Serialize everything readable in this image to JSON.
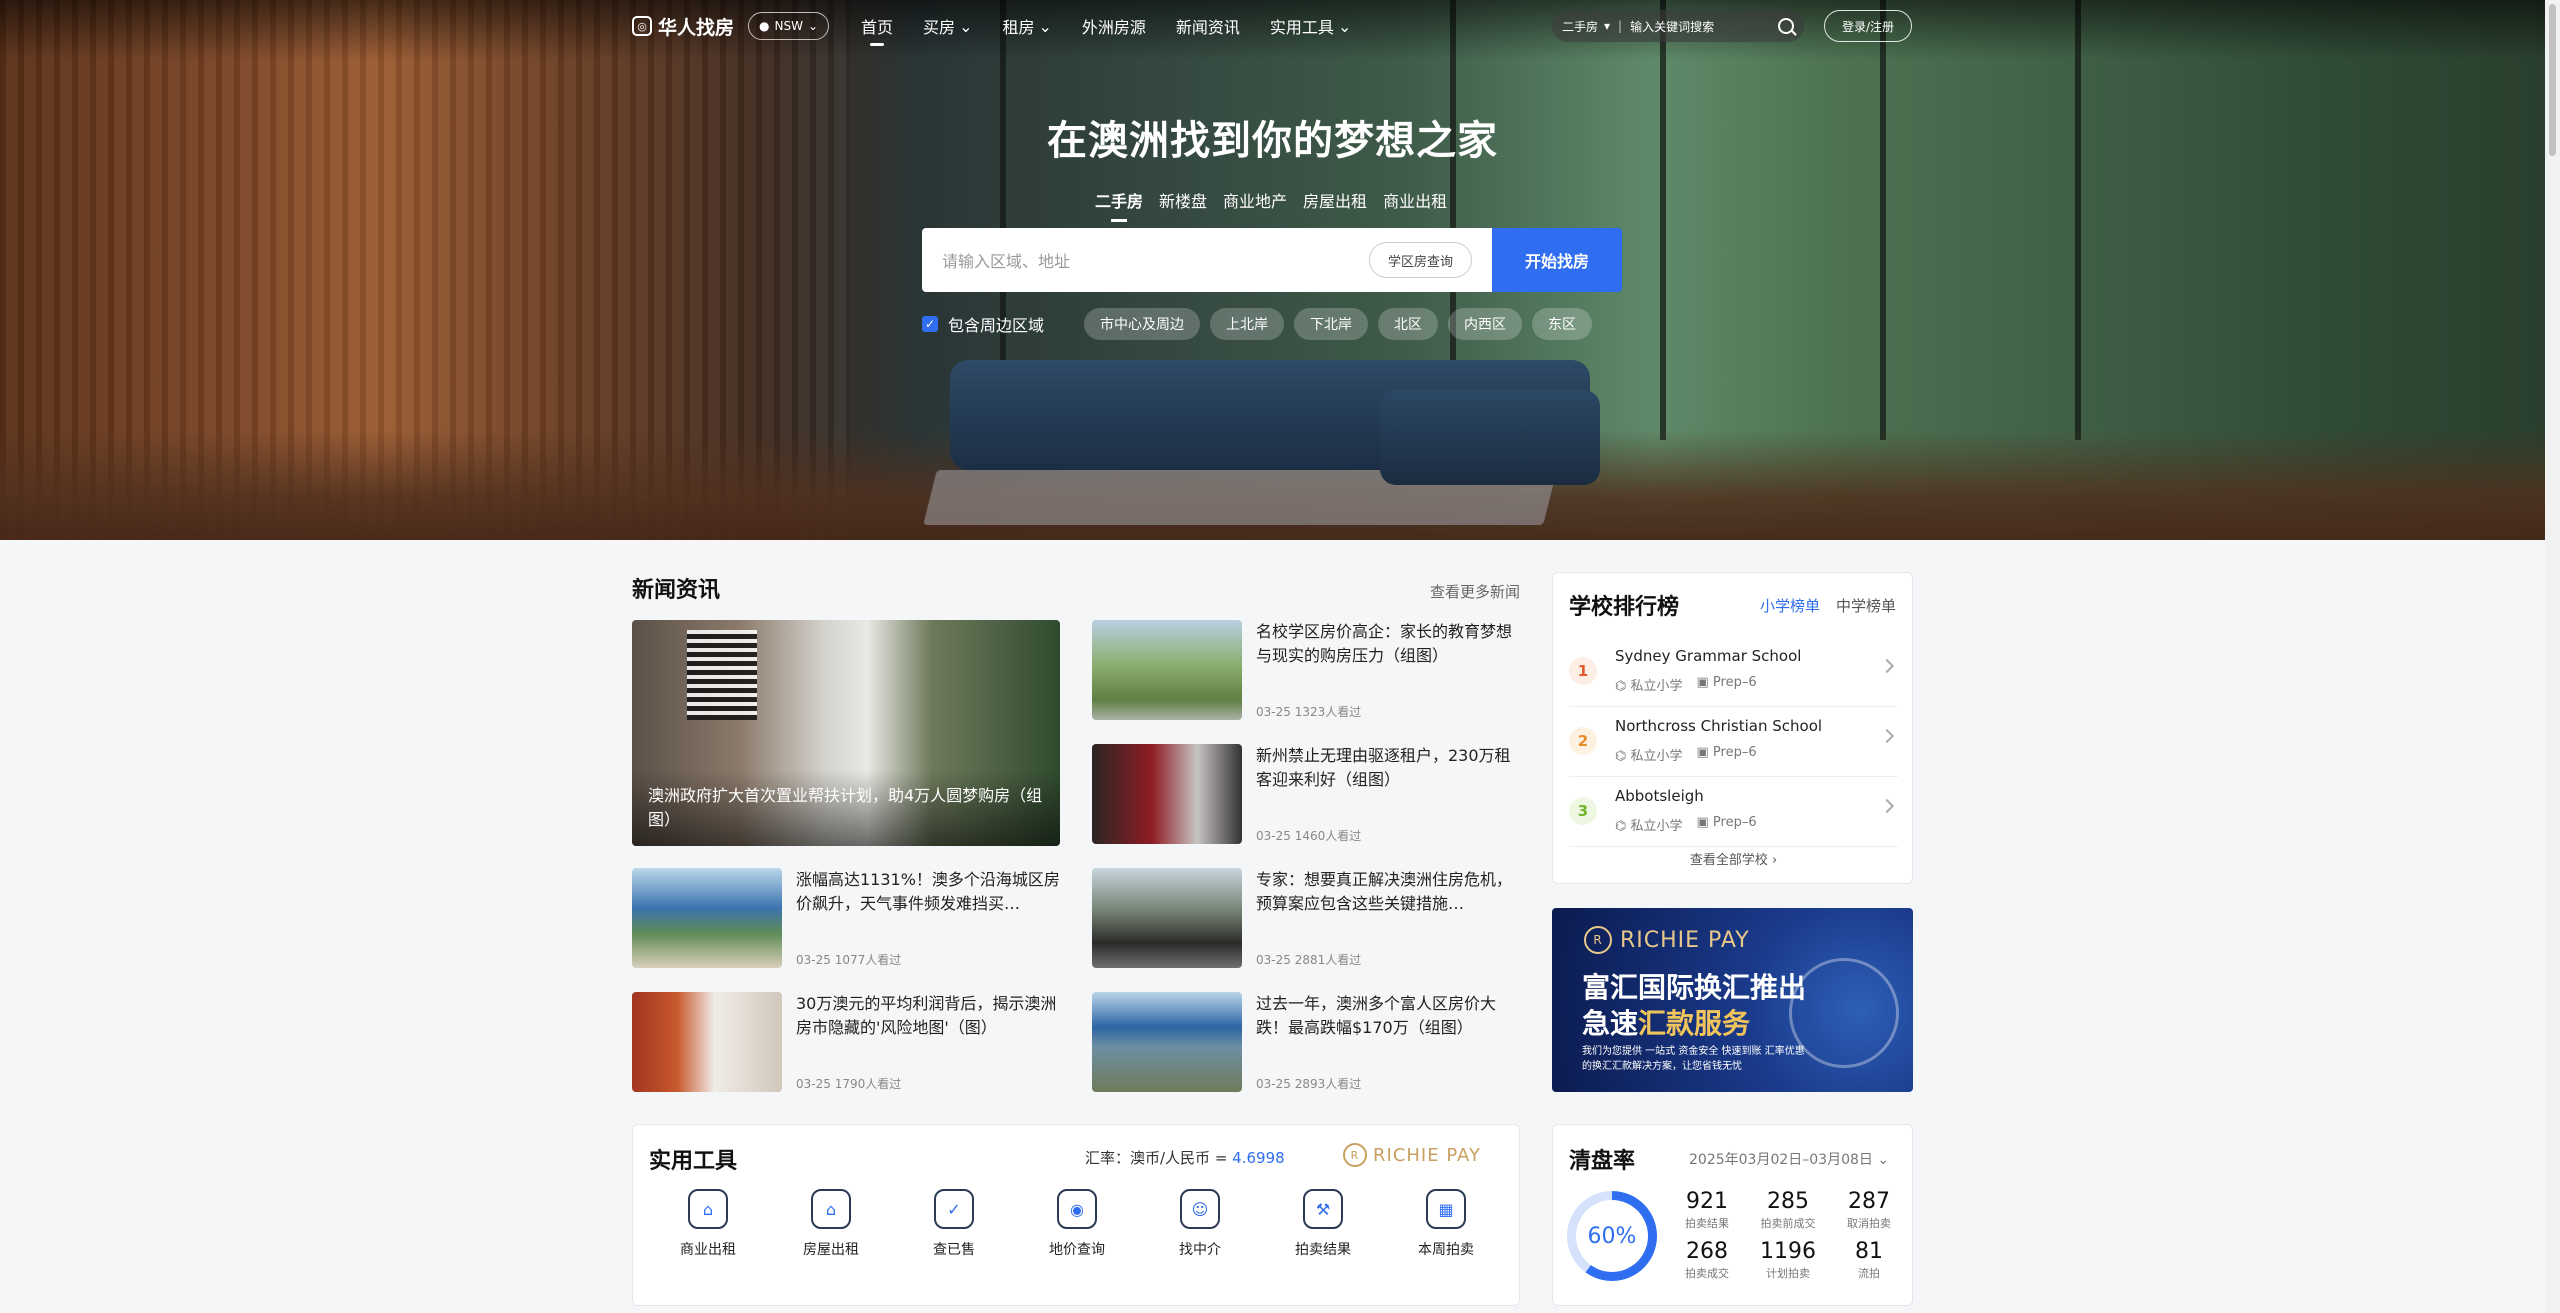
{
  "nav": {
    "logo_text": "华人找房",
    "logo_icon_glyph": "◎",
    "region": "NSW",
    "links": [
      {
        "label": "首页",
        "active": true,
        "dropdown": false
      },
      {
        "label": "买房",
        "active": false,
        "dropdown": true
      },
      {
        "label": "租房",
        "active": false,
        "dropdown": true
      },
      {
        "label": "外洲房源",
        "active": false,
        "dropdown": false
      },
      {
        "label": "新闻资讯",
        "active": false,
        "dropdown": false
      },
      {
        "label": "实用工具",
        "active": false,
        "dropdown": true
      }
    ],
    "search_type": "二手房",
    "search_placeholder": "输入关键词搜索",
    "login_label": "登录/注册"
  },
  "hero": {
    "title": "在澳洲找到你的梦想之家",
    "tabs": [
      "二手房",
      "新楼盘",
      "商业地产",
      "房屋出租",
      "商业出租"
    ],
    "active_tab": 0,
    "search_placeholder": "请输入区域、地址",
    "school_button": "学区房查询",
    "go_button": "开始找房",
    "include_nearby_label": "包含周边区域",
    "include_nearby_checked": true,
    "areas": [
      "市中心及周边",
      "上北岸",
      "下北岸",
      "北区",
      "内西区",
      "东区"
    ]
  },
  "news": {
    "title": "新闻资讯",
    "more": "查看更多新闻",
    "feature": {
      "title": "澳洲政府扩大首次置业帮扶计划，助4万人圆梦购房（组图）"
    },
    "items": [
      {
        "title": "名校学区房价高企：家长的教育梦想与现实的购房压力（组图）",
        "date": "03-25",
        "views": "1323人看过"
      },
      {
        "title": "新州禁止无理由驱逐租户，230万租客迎来利好（组图）",
        "date": "03-25",
        "views": "1460人看过"
      },
      {
        "title": "涨幅高达1131%！澳多个沿海城区房价飙升，天气事件频发难挡买…",
        "date": "03-25",
        "views": "1077人看过"
      },
      {
        "title": "专家：想要真正解决澳洲住房危机，预算案应包含这些关键措施…",
        "date": "03-25",
        "views": "2881人看过"
      },
      {
        "title": "30万澳元的平均利润背后，揭示澳洲房市隐藏的'风险地图'（图）",
        "date": "03-25",
        "views": "1790人看过"
      },
      {
        "title": "过去一年，澳洲多个富人区房价大跌！最高跌幅$170万（组图）",
        "date": "03-25",
        "views": "2893人看过"
      }
    ]
  },
  "tools": {
    "title": "实用工具",
    "rate_label": "汇率：澳币/人民币 = ",
    "rate_value": "4.6998",
    "partner": "RICHIE PAY",
    "items": [
      {
        "label": "商业出租",
        "icon": "storefront-icon"
      },
      {
        "label": "房屋出租",
        "icon": "house-icon"
      },
      {
        "label": "查已售",
        "icon": "checked-shield-icon"
      },
      {
        "label": "地价查询",
        "icon": "map-pin-icon"
      },
      {
        "label": "找中介",
        "icon": "agent-icon"
      },
      {
        "label": "拍卖结果",
        "icon": "gavel-icon"
      },
      {
        "label": "本周拍卖",
        "icon": "calendar-icon"
      }
    ]
  },
  "schools": {
    "title": "学校排行榜",
    "tabs": [
      "小学榜单",
      "中学榜单"
    ],
    "active_tab": 0,
    "items": [
      {
        "rank": "1",
        "name": "Sydney Grammar School",
        "type": "私立小学",
        "grade": "Prep–6"
      },
      {
        "rank": "2",
        "name": "Northcross Christian School",
        "type": "私立小学",
        "grade": "Prep–6"
      },
      {
        "rank": "3",
        "name": "Abbotsleigh",
        "type": "私立小学",
        "grade": "Prep–6"
      }
    ],
    "all_link": "查看全部学校"
  },
  "ad": {
    "brand": "RICHIE PAY",
    "line1": "富汇国际换汇推出",
    "line2_a": "急速",
    "line2_b": "汇款服务",
    "sub1": "我们为您提供 一站式 资金安全 快速到账 汇率优惠",
    "sub2": "的换汇汇款解决方案，让您省钱无忧"
  },
  "clearance": {
    "title": "清盘率",
    "date_range": "2025年03月02日–03月08日",
    "rate": 0.6,
    "rate_label": "60%",
    "stats": [
      {
        "value": "921",
        "label": "拍卖结果"
      },
      {
        "value": "285",
        "label": "拍卖前成交"
      },
      {
        "value": "287",
        "label": "取消拍卖"
      },
      {
        "value": "268",
        "label": "拍卖成交"
      },
      {
        "value": "1196",
        "label": "计划拍卖"
      },
      {
        "value": "81",
        "label": "流拍"
      }
    ]
  }
}
